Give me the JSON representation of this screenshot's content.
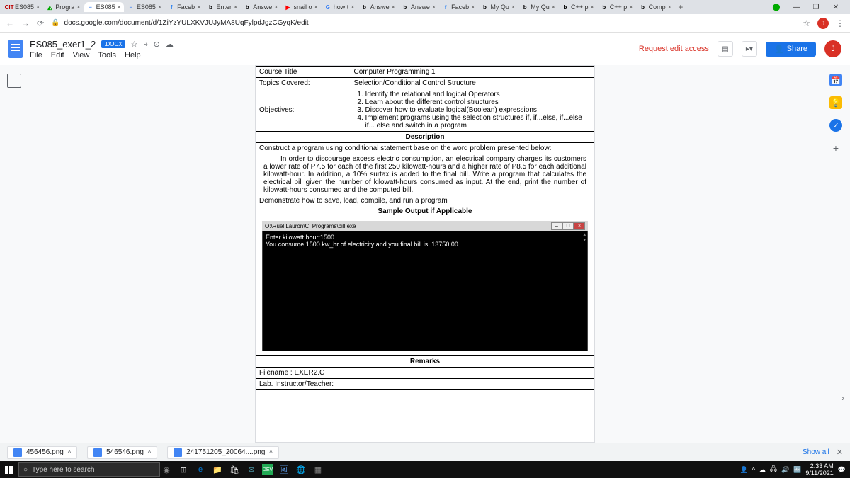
{
  "tabs": [
    {
      "favicon": "CIT",
      "favcolor": "#b00",
      "title": "ES085"
    },
    {
      "favicon": "◭",
      "favcolor": "#0a0",
      "title": "Progra"
    },
    {
      "favicon": "≡",
      "favcolor": "#4285f4",
      "title": "ES085",
      "active": true
    },
    {
      "favicon": "≡",
      "favcolor": "#4285f4",
      "title": "ES085"
    },
    {
      "favicon": "f",
      "favcolor": "#1877f2",
      "title": "Faceb"
    },
    {
      "favicon": "b",
      "favcolor": "#000",
      "title": "Enter"
    },
    {
      "favicon": "b",
      "favcolor": "#000",
      "title": "Answe"
    },
    {
      "favicon": "▶",
      "favcolor": "#f00",
      "title": "snail o"
    },
    {
      "favicon": "G",
      "favcolor": "#4285f4",
      "title": "how t"
    },
    {
      "favicon": "b",
      "favcolor": "#000",
      "title": "Answe"
    },
    {
      "favicon": "b",
      "favcolor": "#000",
      "title": "Answe"
    },
    {
      "favicon": "f",
      "favcolor": "#1877f2",
      "title": "Faceb"
    },
    {
      "favicon": "b",
      "favcolor": "#000",
      "title": "My Qu"
    },
    {
      "favicon": "b",
      "favcolor": "#000",
      "title": "My Qu"
    },
    {
      "favicon": "b",
      "favcolor": "#000",
      "title": "C++ p"
    },
    {
      "favicon": "b",
      "favcolor": "#000",
      "title": "C++ p"
    },
    {
      "favicon": "b",
      "favcolor": "#000",
      "title": "Comp"
    }
  ],
  "url": "docs.google.com/document/d/1ZiYzYULXKVJUJyMA8UqFylpdJgzCGyqK/edit",
  "doc": {
    "title": "ES085_exer1_2",
    "badge": ".DOCX",
    "menus": [
      "File",
      "Edit",
      "View",
      "Tools",
      "Help"
    ],
    "request_edit": "Request edit access",
    "share": "Share",
    "profile": "J"
  },
  "table": {
    "course_title_label": "Course Title",
    "course_title": "Computer Programming 1",
    "topics_label": "Topics Covered:",
    "topics": "Selection/Conditional Control Structure",
    "objectives_label": "Objectives:",
    "objectives": [
      "Identify the relational and logical Operators",
      "Learn about the different control structures",
      "Discover how to evaluate logical(Boolean) expressions",
      "Implement programs using the selection structures if, if...else, if...else if... else and switch in a program"
    ],
    "description_head": "Description",
    "description_intro": "Construct a program using conditional statement base on the word problem presented below:",
    "description_body": "In order to discourage excess electric consumption, an electrical company charges its customers a lower rate of P7.5 for each of the first 250 kilowatt-hours and a higher rate of P8.5 for each additional kilowatt-hour. In addition, a 10% surtax is added to the final bill. Write a program that calculates the electrical bill given the number of kilowatt-hours consumed as input. At the end, print the number of kilowatt-hours consumed and the computed bill.",
    "demo_line": "Demonstrate how to save, load, compile, and run a program",
    "sample_head": "Sample Output if Applicable",
    "console_path": "O:\\Ruel Lauron\\C_Programs\\bill.exe",
    "console_line1": "Enter kilowatt hour:1500",
    "console_line2": "You consume 1500 kw_hr of electricity and you final bill is: 13750.00",
    "remarks_head": "Remarks",
    "filename": "Filename : EXER2.C",
    "instructor": "Lab. Instructor/Teacher:"
  },
  "downloads": {
    "items": [
      "456456.png",
      "546546.png",
      "241751205_20064....png"
    ],
    "show_all": "Show all"
  },
  "taskbar": {
    "search_placeholder": "Type here to search",
    "time": "2:33 AM",
    "date": "9/11/2021"
  }
}
